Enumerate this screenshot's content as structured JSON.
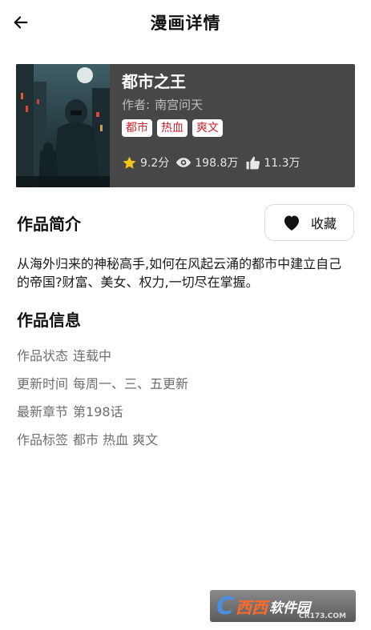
{
  "header": {
    "title": "漫画详情",
    "back_icon": "arrow-left-icon"
  },
  "comic": {
    "name": "都市之王",
    "author_label": "作者:",
    "author": "南宫问天",
    "tags": [
      "都市",
      "热血",
      "爽文"
    ],
    "rating": "9.2分",
    "views": "198.8万",
    "likes": "11.3万"
  },
  "intro_section": {
    "title": "作品简介",
    "favorite_label": "收藏",
    "text": "从海外归来的神秘高手,如何在风起云涌的都市中建立自己的帝国?财富、美女、权力,一切尽在掌握。"
  },
  "info_section": {
    "title": "作品信息",
    "rows": [
      {
        "label": "作品状态",
        "value": "连载中"
      },
      {
        "label": "更新时间",
        "value": "每周一、三、五更新"
      },
      {
        "label": "最新章节",
        "value": "第198话"
      },
      {
        "label": "作品标签",
        "value": "都市 热血 爽文"
      }
    ]
  },
  "watermark": {
    "brand": "西西",
    "suffix": "软件园",
    "url": "CR173.COM"
  },
  "colors": {
    "card_bg": "#474747",
    "tag_text": "#d0222b",
    "star": "#f5c518"
  }
}
